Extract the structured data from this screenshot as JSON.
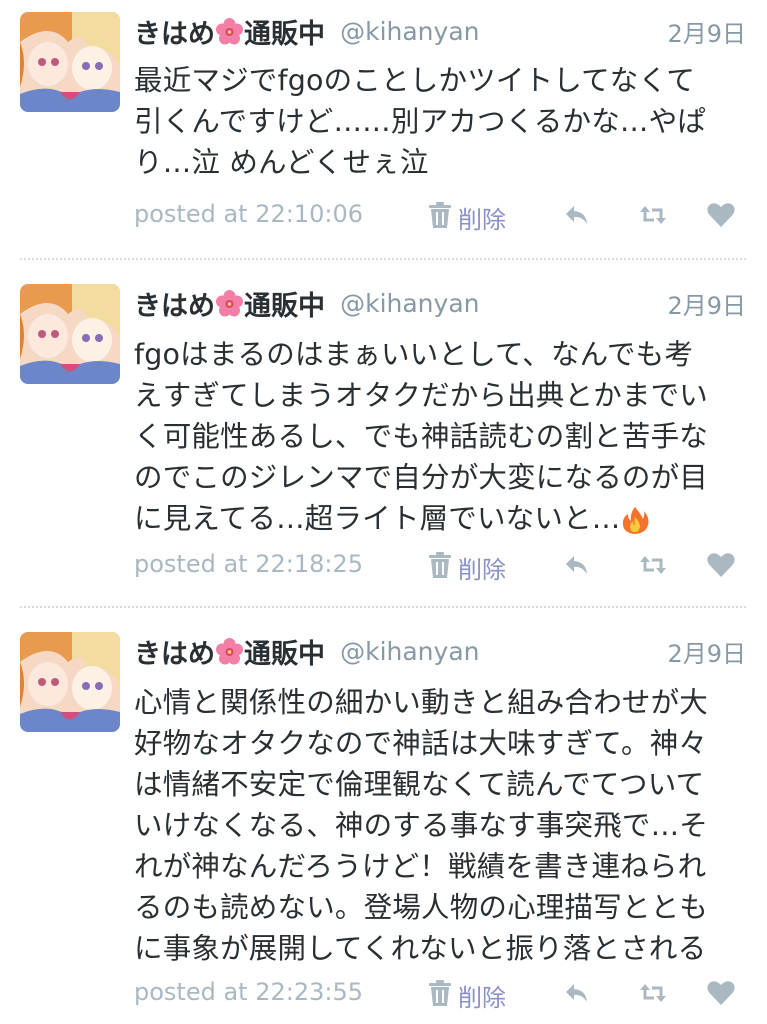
{
  "tweets": [
    {
      "name_a": "きはめ",
      "name_b": "通販中",
      "handle": "@kihanyan",
      "date": "2月9日",
      "lines": [
        "最近マジでfgoのことしかツイトしてなくて",
        "引くんですけど……別アカつくるかな…やぱ",
        "り…泣 めんどくせぇ泣"
      ],
      "posted": "posted at 22:10:06",
      "delete_label": "削除"
    },
    {
      "name_a": "きはめ",
      "name_b": "通販中",
      "handle": "@kihanyan",
      "date": "2月9日",
      "lines": [
        "fgoはまるのはまぁいいとして、なんでも考",
        "えすぎてしまうオタクだから出典とかまでい",
        "く可能性あるし、でも神話読むの割と苦手な",
        "のでこのジレンマで自分が大変になるのが目",
        "に見えてる…超ライト層でいないと…"
      ],
      "posted": "posted at 22:18:25",
      "delete_label": "削除"
    },
    {
      "name_a": "きはめ",
      "name_b": "通販中",
      "handle": "@kihanyan",
      "date": "2月9日",
      "lines": [
        "心情と関係性の細かい動きと組み合わせが大",
        "好物なオタクなので神話は大味すぎて。神々",
        "は情緒不安定で倫理観なくて読んでてついて",
        "いけなくなる、神のする事なす事突飛で…そ",
        "れが神なんだろうけど！戦績を書き連ねられ",
        "るのも読めない。登場人物の心理描写ととも",
        "に事象が展開してくれないと振り落とされる"
      ],
      "posted": "posted at 22:23:55",
      "delete_label": "削除"
    }
  ],
  "colors": {
    "name": "#292f33",
    "meta": "#8899a6",
    "posted": "#aab8c2",
    "delete_link": "#8a91c9",
    "icon": "#aab8c2",
    "divider": "#d7dde2"
  },
  "icons": {
    "name_emoji": "hibiscus-icon",
    "fire_emoji": "fire-icon",
    "trash": "trash-icon",
    "reply": "reply-icon",
    "retweet": "retweet-icon",
    "like": "heart-icon"
  }
}
